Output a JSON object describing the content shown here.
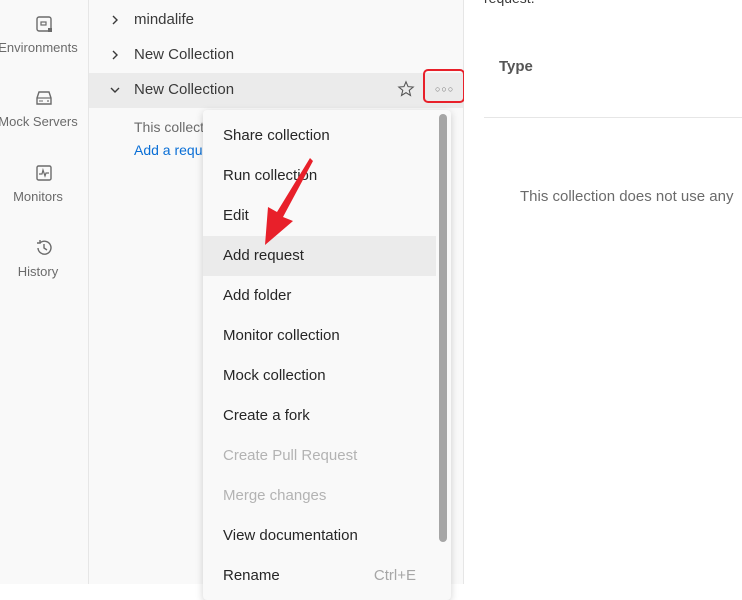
{
  "leftnav": {
    "items": [
      {
        "label": "Environments",
        "icon": "environments-icon"
      },
      {
        "label": "Mock Servers",
        "icon": "mock-server-icon"
      },
      {
        "label": "Monitors",
        "icon": "monitor-icon"
      },
      {
        "label": "History",
        "icon": "history-icon"
      }
    ]
  },
  "tree": {
    "collections": [
      {
        "name": "mindalife",
        "expanded": false
      },
      {
        "name": "New Collection",
        "expanded": false
      },
      {
        "name": "New Collection",
        "expanded": true
      }
    ],
    "empty_text": "This collection is empty",
    "add_request_link": "Add a request"
  },
  "main": {
    "partial_text": "request.",
    "type_heading": "Type",
    "no_variables_text": "This collection does not use any"
  },
  "context_menu": {
    "items": [
      {
        "label": "Share collection",
        "disabled": false
      },
      {
        "label": "Run collection",
        "disabled": false
      },
      {
        "label": "Edit",
        "disabled": false
      },
      {
        "label": "Add request",
        "disabled": false,
        "highlighted": true
      },
      {
        "label": "Add folder",
        "disabled": false
      },
      {
        "label": "Monitor collection",
        "disabled": false
      },
      {
        "label": "Mock collection",
        "disabled": false
      },
      {
        "label": "Create a fork",
        "disabled": false
      },
      {
        "label": "Create Pull Request",
        "disabled": true
      },
      {
        "label": "Merge changes",
        "disabled": true
      },
      {
        "label": "View documentation",
        "disabled": false
      },
      {
        "label": "Rename",
        "disabled": false,
        "shortcut": "Ctrl+E"
      }
    ]
  },
  "annotations": {
    "highlight_color": "#e8202a",
    "arrow_color": "#e8202a"
  }
}
